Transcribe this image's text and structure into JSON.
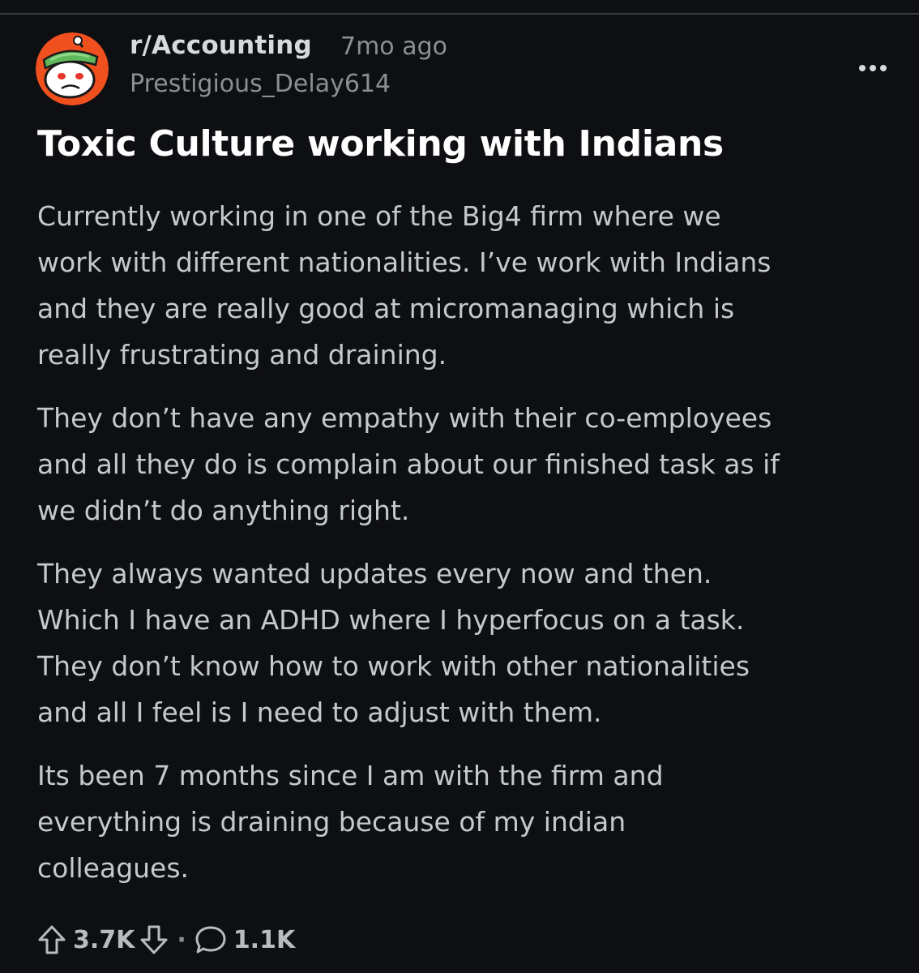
{
  "post": {
    "subreddit": "r/Accounting",
    "time_ago": "7mo ago",
    "author": "Prestigious_Delay614",
    "title": "Toxic Culture working with Indians",
    "paragraphs": [
      "Currently working in one of the Big4 firm where we\nwork with different nationalities. I’ve work with Indians\nand they are really good at micromanaging which is\nreally frustrating and draining.",
      "They don’t have any empathy with their co-employees\nand all they do is complain about our finished task as if\nwe didn’t do anything right.",
      "They always wanted updates every now and then.\nWhich I have an ADHD where I hyperfocus on a task.\nThey don’t know how to work with other nationalities\nand all I feel is I need to adjust with them.",
      "Its been 7 months since I am with the firm and\neverything is draining because of my indian\ncolleagues."
    ]
  },
  "actions": {
    "upvotes": "3.7K",
    "separator": "·",
    "comments": "1.1K"
  },
  "icons": {
    "avatar": "snoo-avatar-icon",
    "more": "more-options-icon",
    "upvote": "upvote-arrow-icon",
    "downvote": "downvote-arrow-icon",
    "comment": "comment-bubble-icon"
  },
  "colors": {
    "background": "#0e0f12",
    "avatar_orange": "#f0501e",
    "visor_green": "#5fb85a",
    "title": "#ffffff",
    "text": "#c5c8cc",
    "muted": "#8b8f94"
  }
}
